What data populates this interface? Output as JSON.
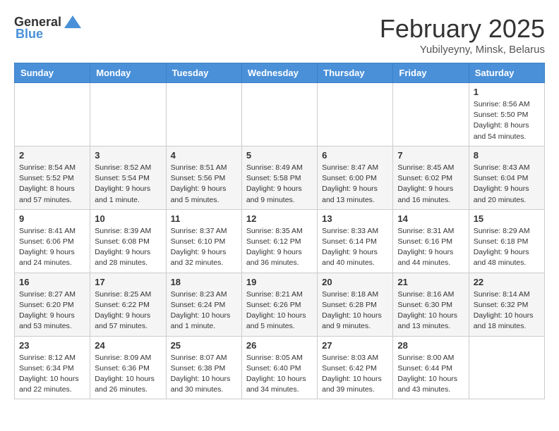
{
  "header": {
    "logo_general": "General",
    "logo_blue": "Blue",
    "month_title": "February 2025",
    "location": "Yubilyeyny, Minsk, Belarus"
  },
  "days_of_week": [
    "Sunday",
    "Monday",
    "Tuesday",
    "Wednesday",
    "Thursday",
    "Friday",
    "Saturday"
  ],
  "weeks": [
    [
      {
        "day": "",
        "info": ""
      },
      {
        "day": "",
        "info": ""
      },
      {
        "day": "",
        "info": ""
      },
      {
        "day": "",
        "info": ""
      },
      {
        "day": "",
        "info": ""
      },
      {
        "day": "",
        "info": ""
      },
      {
        "day": "1",
        "info": "Sunrise: 8:56 AM\nSunset: 5:50 PM\nDaylight: 8 hours and 54 minutes."
      }
    ],
    [
      {
        "day": "2",
        "info": "Sunrise: 8:54 AM\nSunset: 5:52 PM\nDaylight: 8 hours and 57 minutes."
      },
      {
        "day": "3",
        "info": "Sunrise: 8:52 AM\nSunset: 5:54 PM\nDaylight: 9 hours and 1 minute."
      },
      {
        "day": "4",
        "info": "Sunrise: 8:51 AM\nSunset: 5:56 PM\nDaylight: 9 hours and 5 minutes."
      },
      {
        "day": "5",
        "info": "Sunrise: 8:49 AM\nSunset: 5:58 PM\nDaylight: 9 hours and 9 minutes."
      },
      {
        "day": "6",
        "info": "Sunrise: 8:47 AM\nSunset: 6:00 PM\nDaylight: 9 hours and 13 minutes."
      },
      {
        "day": "7",
        "info": "Sunrise: 8:45 AM\nSunset: 6:02 PM\nDaylight: 9 hours and 16 minutes."
      },
      {
        "day": "8",
        "info": "Sunrise: 8:43 AM\nSunset: 6:04 PM\nDaylight: 9 hours and 20 minutes."
      }
    ],
    [
      {
        "day": "9",
        "info": "Sunrise: 8:41 AM\nSunset: 6:06 PM\nDaylight: 9 hours and 24 minutes."
      },
      {
        "day": "10",
        "info": "Sunrise: 8:39 AM\nSunset: 6:08 PM\nDaylight: 9 hours and 28 minutes."
      },
      {
        "day": "11",
        "info": "Sunrise: 8:37 AM\nSunset: 6:10 PM\nDaylight: 9 hours and 32 minutes."
      },
      {
        "day": "12",
        "info": "Sunrise: 8:35 AM\nSunset: 6:12 PM\nDaylight: 9 hours and 36 minutes."
      },
      {
        "day": "13",
        "info": "Sunrise: 8:33 AM\nSunset: 6:14 PM\nDaylight: 9 hours and 40 minutes."
      },
      {
        "day": "14",
        "info": "Sunrise: 8:31 AM\nSunset: 6:16 PM\nDaylight: 9 hours and 44 minutes."
      },
      {
        "day": "15",
        "info": "Sunrise: 8:29 AM\nSunset: 6:18 PM\nDaylight: 9 hours and 48 minutes."
      }
    ],
    [
      {
        "day": "16",
        "info": "Sunrise: 8:27 AM\nSunset: 6:20 PM\nDaylight: 9 hours and 53 minutes."
      },
      {
        "day": "17",
        "info": "Sunrise: 8:25 AM\nSunset: 6:22 PM\nDaylight: 9 hours and 57 minutes."
      },
      {
        "day": "18",
        "info": "Sunrise: 8:23 AM\nSunset: 6:24 PM\nDaylight: 10 hours and 1 minute."
      },
      {
        "day": "19",
        "info": "Sunrise: 8:21 AM\nSunset: 6:26 PM\nDaylight: 10 hours and 5 minutes."
      },
      {
        "day": "20",
        "info": "Sunrise: 8:18 AM\nSunset: 6:28 PM\nDaylight: 10 hours and 9 minutes."
      },
      {
        "day": "21",
        "info": "Sunrise: 8:16 AM\nSunset: 6:30 PM\nDaylight: 10 hours and 13 minutes."
      },
      {
        "day": "22",
        "info": "Sunrise: 8:14 AM\nSunset: 6:32 PM\nDaylight: 10 hours and 18 minutes."
      }
    ],
    [
      {
        "day": "23",
        "info": "Sunrise: 8:12 AM\nSunset: 6:34 PM\nDaylight: 10 hours and 22 minutes."
      },
      {
        "day": "24",
        "info": "Sunrise: 8:09 AM\nSunset: 6:36 PM\nDaylight: 10 hours and 26 minutes."
      },
      {
        "day": "25",
        "info": "Sunrise: 8:07 AM\nSunset: 6:38 PM\nDaylight: 10 hours and 30 minutes."
      },
      {
        "day": "26",
        "info": "Sunrise: 8:05 AM\nSunset: 6:40 PM\nDaylight: 10 hours and 34 minutes."
      },
      {
        "day": "27",
        "info": "Sunrise: 8:03 AM\nSunset: 6:42 PM\nDaylight: 10 hours and 39 minutes."
      },
      {
        "day": "28",
        "info": "Sunrise: 8:00 AM\nSunset: 6:44 PM\nDaylight: 10 hours and 43 minutes."
      },
      {
        "day": "",
        "info": ""
      }
    ]
  ]
}
